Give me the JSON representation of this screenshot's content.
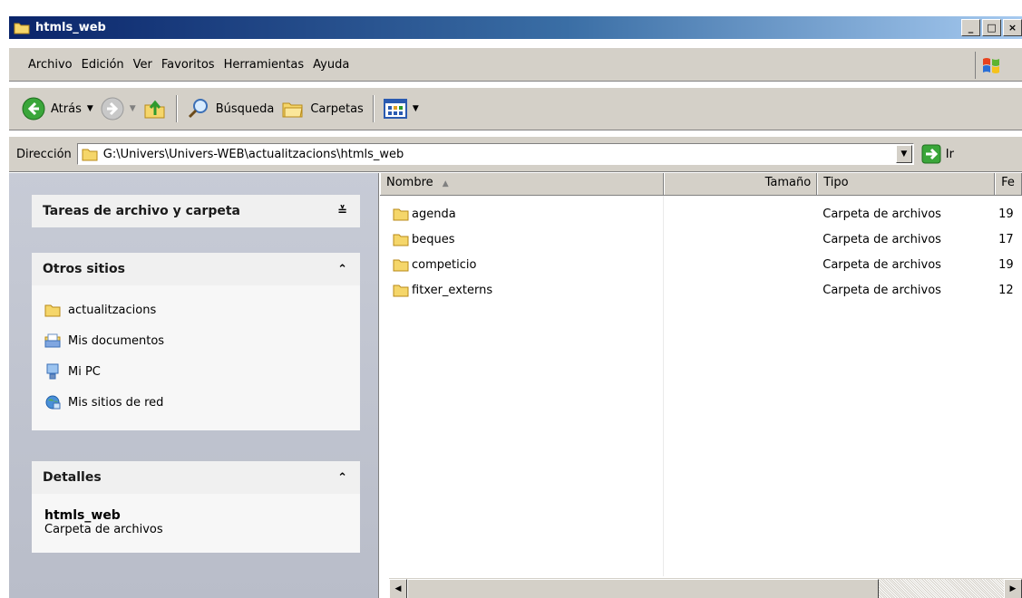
{
  "window": {
    "title": "htmls_web",
    "buttons": [
      "_",
      "□",
      "×"
    ]
  },
  "menu": {
    "items": [
      {
        "label": "Archivo"
      },
      {
        "label": "Edición"
      },
      {
        "label": "Ver"
      },
      {
        "label": "Favoritos"
      },
      {
        "label": "Herramientas"
      },
      {
        "label": "Ayuda"
      }
    ]
  },
  "toolbar": {
    "back_label": "Atrás",
    "search_label": "Búsqueda",
    "folders_label": "Carpetas"
  },
  "address": {
    "label": "Dirección",
    "value": "G:\\Univers\\Univers-WEB\\actualitzacions\\htmls_web",
    "go_label": "Ir"
  },
  "tasks": {
    "file_tasks_title": "Tareas de archivo y carpeta",
    "other_places_title": "Otros sitios",
    "other_places": [
      {
        "label": "actualitzacions",
        "icon": "folder-icon"
      },
      {
        "label": "Mis documentos",
        "icon": "my-documents-icon"
      },
      {
        "label": "Mi PC",
        "icon": "my-computer-icon"
      },
      {
        "label": "Mis sitios de red",
        "icon": "network-places-icon"
      }
    ],
    "details_title": "Detalles",
    "details_name": "htmls_web",
    "details_type": "Carpeta de archivos"
  },
  "list": {
    "columns": {
      "name": "Nombre",
      "size": "Tamaño",
      "type": "Tipo",
      "date": "Fe"
    },
    "rows": [
      {
        "name": "agenda",
        "size": "",
        "type": "Carpeta de archivos",
        "date": "19"
      },
      {
        "name": "beques",
        "size": "",
        "type": "Carpeta de archivos",
        "date": "17"
      },
      {
        "name": "competicio",
        "size": "",
        "type": "Carpeta de archivos",
        "date": "19"
      },
      {
        "name": "fitxer_externs",
        "size": "",
        "type": "Carpeta de archivos",
        "date": "12"
      }
    ]
  },
  "colors": {
    "titlebar_start": "#0a246a",
    "chrome": "#d4d0c8",
    "task_pane_bg": "#c7cbd6"
  }
}
